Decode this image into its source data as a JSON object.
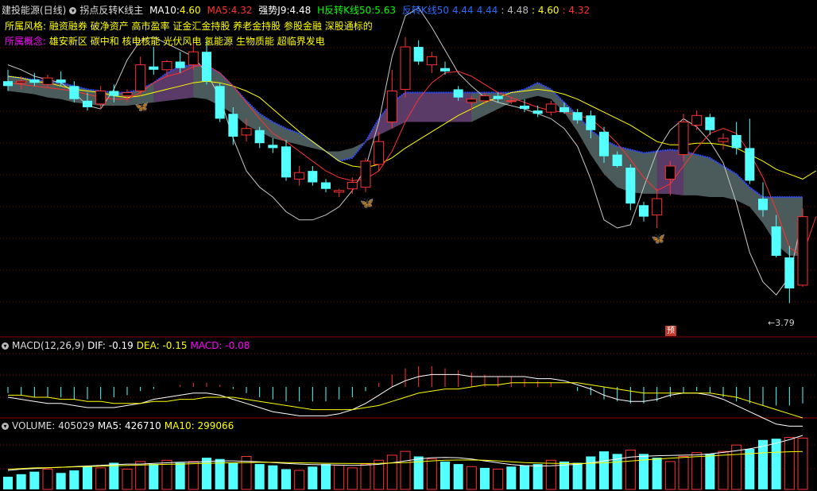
{
  "header": {
    "stock": "建投能源(日线)",
    "indicator": "拐点反转K线主",
    "ma10_label": "MA10:",
    "ma10_value": "4.60",
    "ma5_label": "MA5:",
    "ma5_value": "4.32",
    "strong_label": "强势J9:",
    "strong_value": "4.48",
    "h_rev_label": "H反转K线50:",
    "h_rev_value": "5.63",
    "rev_label": "反转K线50",
    "rev_value1": "4.44",
    "rev_value2": "4.44",
    "extra_value1": ": 4.48",
    "extra_value2": ": 4.60",
    "extra_value3": ": 4.32"
  },
  "info": {
    "style_label": "所属风格:",
    "style_value": "融资融券 破净资产 高市盈率 证金汇金持股 养老金持股 参股金融 深股通标的",
    "concept_label": "所属概念:",
    "concept_value": "雄安新区 碳中和 核电核能 光伏风电 氢能源 生物质能 超临界发电"
  },
  "annotations": {
    "low_price": "←3.79",
    "forecast": "预"
  },
  "macd_header": {
    "label": "MACD(12,26,9)",
    "dif": "DIF: -0.19",
    "dea": "DEA: -0.15",
    "macd": "MACD: -0.08"
  },
  "volume_header": {
    "label": "VOLUME: 405029",
    "ma5": "MA5: 426710",
    "ma10": "MA10: 299066"
  },
  "colors": {
    "background": "#000000",
    "up": "#ff3232",
    "down": "#54ffff",
    "yellow": "#ffff00",
    "white": "#ffffff",
    "magenta": "#ff00ff",
    "grid": "#8b0000",
    "band_gray": "#4f5f5f",
    "band_purple": "#5a3a66",
    "blue_edge": "#2a4bff"
  },
  "icons": {
    "butterfly": "butterfly-icon",
    "circle": "circle-icon"
  },
  "chart_data": {
    "type": "candlestick",
    "candles": [
      {
        "o": 5.15,
        "h": 5.22,
        "l": 5.09,
        "c": 5.12
      },
      {
        "o": 5.14,
        "h": 5.18,
        "l": 5.1,
        "c": 5.15
      },
      {
        "o": 5.16,
        "h": 5.2,
        "l": 5.12,
        "c": 5.14
      },
      {
        "o": 5.13,
        "h": 5.19,
        "l": 5.11,
        "c": 5.17
      },
      {
        "o": 5.16,
        "h": 5.21,
        "l": 5.12,
        "c": 5.14
      },
      {
        "o": 5.12,
        "h": 5.15,
        "l": 5.02,
        "c": 5.04
      },
      {
        "o": 5.03,
        "h": 5.08,
        "l": 4.97,
        "c": 4.99
      },
      {
        "o": 5.01,
        "h": 5.12,
        "l": 4.98,
        "c": 5.09
      },
      {
        "o": 5.09,
        "h": 5.13,
        "l": 5.02,
        "c": 5.06
      },
      {
        "o": 5.06,
        "h": 5.1,
        "l": 5.02,
        "c": 5.08
      },
      {
        "o": 5.09,
        "h": 5.3,
        "l": 5.06,
        "c": 5.25
      },
      {
        "o": 5.24,
        "h": 5.36,
        "l": 5.19,
        "c": 5.22
      },
      {
        "o": 5.22,
        "h": 5.28,
        "l": 5.18,
        "c": 5.27
      },
      {
        "o": 5.27,
        "h": 5.33,
        "l": 5.2,
        "c": 5.23
      },
      {
        "o": 5.25,
        "h": 5.38,
        "l": 5.22,
        "c": 5.33
      },
      {
        "o": 5.33,
        "h": 5.4,
        "l": 5.13,
        "c": 5.15
      },
      {
        "o": 5.12,
        "h": 5.14,
        "l": 4.9,
        "c": 4.92
      },
      {
        "o": 4.95,
        "h": 4.99,
        "l": 4.76,
        "c": 4.81
      },
      {
        "o": 4.82,
        "h": 4.92,
        "l": 4.78,
        "c": 4.86
      },
      {
        "o": 4.85,
        "h": 4.87,
        "l": 4.74,
        "c": 4.77
      },
      {
        "o": 4.76,
        "h": 4.8,
        "l": 4.71,
        "c": 4.74
      },
      {
        "o": 4.75,
        "h": 4.79,
        "l": 4.54,
        "c": 4.56
      },
      {
        "o": 4.55,
        "h": 4.63,
        "l": 4.51,
        "c": 4.59
      },
      {
        "o": 4.6,
        "h": 4.63,
        "l": 4.51,
        "c": 4.53
      },
      {
        "o": 4.53,
        "h": 4.55,
        "l": 4.47,
        "c": 4.49
      },
      {
        "o": 4.47,
        "h": 4.49,
        "l": 4.44,
        "c": 4.48
      },
      {
        "o": 4.49,
        "h": 4.56,
        "l": 4.46,
        "c": 4.53
      },
      {
        "o": 4.5,
        "h": 4.68,
        "l": 4.47,
        "c": 4.66
      },
      {
        "o": 4.64,
        "h": 4.84,
        "l": 4.6,
        "c": 4.78
      },
      {
        "o": 4.9,
        "h": 5.22,
        "l": 4.86,
        "c": 5.09
      },
      {
        "o": 5.1,
        "h": 5.42,
        "l": 5.05,
        "c": 5.36
      },
      {
        "o": 5.36,
        "h": 5.4,
        "l": 5.25,
        "c": 5.27
      },
      {
        "o": 5.25,
        "h": 5.33,
        "l": 5.2,
        "c": 5.3
      },
      {
        "o": 5.23,
        "h": 5.27,
        "l": 5.19,
        "c": 5.21
      },
      {
        "o": 5.1,
        "h": 5.12,
        "l": 5.03,
        "c": 5.05
      },
      {
        "o": 5.02,
        "h": 5.06,
        "l": 4.97,
        "c": 5.04
      },
      {
        "o": 5.03,
        "h": 5.08,
        "l": 5.01,
        "c": 5.06
      },
      {
        "o": 5.06,
        "h": 5.08,
        "l": 5.02,
        "c": 5.04
      },
      {
        "o": 5.03,
        "h": 5.05,
        "l": 5.01,
        "c": 5.03
      },
      {
        "o": 5.0,
        "h": 5.04,
        "l": 4.96,
        "c": 4.98
      },
      {
        "o": 4.97,
        "h": 5.0,
        "l": 4.93,
        "c": 4.95
      },
      {
        "o": 4.96,
        "h": 5.03,
        "l": 4.94,
        "c": 5.01
      },
      {
        "o": 4.99,
        "h": 5.02,
        "l": 4.95,
        "c": 4.96
      },
      {
        "o": 4.96,
        "h": 4.98,
        "l": 4.89,
        "c": 4.91
      },
      {
        "o": 4.94,
        "h": 4.97,
        "l": 4.8,
        "c": 4.85
      },
      {
        "o": 4.84,
        "h": 4.87,
        "l": 4.65,
        "c": 4.69
      },
      {
        "o": 4.7,
        "h": 4.72,
        "l": 4.62,
        "c": 4.63
      },
      {
        "o": 4.62,
        "h": 4.64,
        "l": 4.36,
        "c": 4.4
      },
      {
        "o": 4.39,
        "h": 4.41,
        "l": 4.29,
        "c": 4.32
      },
      {
        "o": 4.33,
        "h": 4.49,
        "l": 4.25,
        "c": 4.43
      },
      {
        "o": 4.55,
        "h": 4.66,
        "l": 4.45,
        "c": 4.63
      },
      {
        "o": 4.7,
        "h": 4.95,
        "l": 4.66,
        "c": 4.9
      },
      {
        "o": 4.88,
        "h": 4.97,
        "l": 4.85,
        "c": 4.94
      },
      {
        "o": 4.93,
        "h": 4.95,
        "l": 4.82,
        "c": 4.85
      },
      {
        "o": 4.78,
        "h": 4.83,
        "l": 4.73,
        "c": 4.8
      },
      {
        "o": 4.82,
        "h": 4.9,
        "l": 4.7,
        "c": 4.74
      },
      {
        "o": 4.74,
        "h": 4.92,
        "l": 4.52,
        "c": 4.54
      },
      {
        "o": 4.43,
        "h": 4.53,
        "l": 4.32,
        "c": 4.36
      },
      {
        "o": 4.26,
        "h": 4.33,
        "l": 4.07,
        "c": 4.08
      },
      {
        "o": 4.07,
        "h": 4.14,
        "l": 3.79,
        "c": 3.88
      },
      {
        "o": 3.9,
        "h": 4.37,
        "l": 3.89,
        "c": 4.32
      }
    ],
    "ma5": [
      5.14,
      5.13,
      5.12,
      5.11,
      5.1,
      5.09,
      5.07,
      5.05,
      5.04,
      5.04,
      5.08,
      5.14,
      5.18,
      5.2,
      5.24,
      5.25,
      5.2,
      5.12,
      5.02,
      4.92,
      4.83,
      4.78,
      4.72,
      4.66,
      4.6,
      4.56,
      4.54,
      4.55,
      4.6,
      4.72,
      4.9,
      5.04,
      5.14,
      5.2,
      5.21,
      5.18,
      5.13,
      5.08,
      5.05,
      5.02,
      4.99,
      4.97,
      4.96,
      4.94,
      4.92,
      4.85,
      4.77,
      4.67,
      4.56,
      4.48,
      4.52,
      4.63,
      4.74,
      4.83,
      4.86,
      4.83,
      4.71,
      4.56,
      4.36,
      4.13,
      4.08,
      4.32
    ],
    "ma10": [
      5.18,
      5.17,
      5.15,
      5.14,
      5.12,
      5.1,
      5.09,
      5.08,
      5.06,
      5.05,
      5.06,
      5.08,
      5.1,
      5.12,
      5.14,
      5.15,
      5.14,
      5.12,
      5.09,
      5.05,
      4.98,
      4.91,
      4.84,
      4.78,
      4.72,
      4.66,
      4.63,
      4.62,
      4.64,
      4.68,
      4.74,
      4.79,
      4.84,
      4.89,
      4.94,
      4.98,
      5.02,
      5.05,
      5.08,
      5.09,
      5.1,
      5.09,
      5.07,
      5.04,
      5.0,
      4.96,
      4.92,
      4.88,
      4.83,
      4.78,
      4.76,
      4.76,
      4.77,
      4.77,
      4.76,
      4.74,
      4.7,
      4.66,
      4.61,
      4.58,
      4.55,
      4.6
    ],
    "strong_j9": [
      5.25,
      5.22,
      5.18,
      5.16,
      5.14,
      5.08,
      5.0,
      4.98,
      5.1,
      5.28,
      5.4,
      5.42,
      5.38,
      5.34,
      5.3,
      5.2,
      5.05,
      4.8,
      4.6,
      4.5,
      4.44,
      4.35,
      4.3,
      4.3,
      4.33,
      4.38,
      4.48,
      4.62,
      4.9,
      5.3,
      5.55,
      5.6,
      5.48,
      5.34,
      5.2,
      5.12,
      5.05,
      5.02,
      5.0,
      4.98,
      4.95,
      4.92,
      4.86,
      4.75,
      4.55,
      4.3,
      4.25,
      4.27,
      4.5,
      4.72,
      4.85,
      4.92,
      4.87,
      4.78,
      4.65,
      4.4,
      4.1,
      3.92,
      3.84,
      3.95,
      4.32
    ],
    "band_upper": [
      5.18,
      5.17,
      5.16,
      5.15,
      5.14,
      5.12,
      5.1,
      5.09,
      5.08,
      5.08,
      5.1,
      5.14,
      5.2,
      5.24,
      5.25,
      5.24,
      5.2,
      5.12,
      5.03,
      4.95,
      4.9,
      4.86,
      4.83,
      4.78,
      4.72,
      4.66,
      4.68,
      4.78,
      4.92,
      5.02,
      5.08,
      5.08,
      5.08,
      5.08,
      5.08,
      5.08,
      5.08,
      5.08,
      5.08,
      5.1,
      5.14,
      5.1,
      5.02,
      4.94,
      4.85,
      4.79,
      4.75,
      4.73,
      4.71,
      4.72,
      4.73,
      4.72,
      4.7,
      4.68,
      4.63,
      4.58,
      4.5,
      4.44,
      4.44,
      4.44,
      4.44
    ],
    "band_lower": [
      5.09,
      5.08,
      5.07,
      5.05,
      5.04,
      5.02,
      5.01,
      5.0,
      5.0,
      5.0,
      5.01,
      5.02,
      5.03,
      5.04,
      5.05,
      5.04,
      5.0,
      4.95,
      4.88,
      4.84,
      4.8,
      4.78,
      4.76,
      4.74,
      4.72,
      4.72,
      4.74,
      4.78,
      4.82,
      4.86,
      4.9,
      4.9,
      4.9,
      4.9,
      4.9,
      4.9,
      4.94,
      4.98,
      5.02,
      5.04,
      5.06,
      5.04,
      4.96,
      4.84,
      4.7,
      4.58,
      4.5,
      4.47,
      4.46,
      4.46,
      4.46,
      4.45,
      4.45,
      4.44,
      4.44,
      4.42,
      4.38,
      4.28,
      4.15,
      4.08,
      4.08
    ],
    "band_purple_ranges": [
      [
        11,
        14
      ],
      [
        27,
        35
      ],
      [
        49,
        51
      ]
    ],
    "butterflies": [
      10,
      27,
      49
    ],
    "macd_hist": [
      -0.03,
      -0.04,
      -0.05,
      -0.05,
      -0.05,
      -0.06,
      -0.06,
      -0.06,
      -0.05,
      -0.04,
      -0.02,
      -0.01,
      0.0,
      0.01,
      0.02,
      0.02,
      0.01,
      -0.01,
      -0.03,
      -0.05,
      -0.06,
      -0.07,
      -0.07,
      -0.07,
      -0.07,
      -0.06,
      -0.05,
      -0.02,
      0.02,
      0.06,
      0.09,
      0.1,
      0.1,
      0.09,
      0.08,
      0.07,
      0.06,
      0.05,
      0.05,
      0.04,
      0.03,
      0.02,
      0.0,
      -0.02,
      -0.04,
      -0.06,
      -0.07,
      -0.08,
      -0.08,
      -0.07,
      -0.05,
      -0.03,
      -0.02,
      -0.03,
      -0.05,
      -0.07,
      -0.08,
      -0.09,
      -0.09,
      -0.09,
      -0.08
    ],
    "dif": [
      -0.05,
      -0.06,
      -0.07,
      -0.08,
      -0.08,
      -0.09,
      -0.1,
      -0.1,
      -0.1,
      -0.09,
      -0.08,
      -0.06,
      -0.05,
      -0.04,
      -0.03,
      -0.03,
      -0.04,
      -0.06,
      -0.08,
      -0.1,
      -0.12,
      -0.13,
      -0.14,
      -0.14,
      -0.14,
      -0.13,
      -0.11,
      -0.08,
      -0.04,
      0.0,
      0.03,
      0.05,
      0.06,
      0.06,
      0.06,
      0.05,
      0.05,
      0.05,
      0.05,
      0.05,
      0.04,
      0.04,
      0.03,
      0.01,
      -0.01,
      -0.04,
      -0.06,
      -0.07,
      -0.07,
      -0.06,
      -0.04,
      -0.03,
      -0.03,
      -0.04,
      -0.06,
      -0.09,
      -0.12,
      -0.15,
      -0.18,
      -0.19,
      -0.19
    ],
    "dea": [
      -0.04,
      -0.04,
      -0.05,
      -0.05,
      -0.06,
      -0.06,
      -0.07,
      -0.07,
      -0.08,
      -0.08,
      -0.08,
      -0.07,
      -0.07,
      -0.06,
      -0.06,
      -0.05,
      -0.05,
      -0.05,
      -0.06,
      -0.07,
      -0.08,
      -0.09,
      -0.1,
      -0.11,
      -0.11,
      -0.11,
      -0.11,
      -0.1,
      -0.09,
      -0.07,
      -0.05,
      -0.03,
      -0.02,
      -0.01,
      -0.01,
      0.0,
      0.01,
      0.01,
      0.02,
      0.02,
      0.02,
      0.02,
      0.02,
      0.02,
      0.01,
      0.0,
      -0.01,
      -0.02,
      -0.03,
      -0.03,
      -0.03,
      -0.03,
      -0.03,
      -0.03,
      -0.04,
      -0.05,
      -0.07,
      -0.09,
      -0.11,
      -0.13,
      -0.15
    ],
    "volume": [
      100,
      120,
      140,
      160,
      130,
      150,
      180,
      170,
      210,
      160,
      220,
      200,
      230,
      210,
      220,
      250,
      240,
      210,
      260,
      200,
      190,
      160,
      150,
      180,
      200,
      190,
      170,
      200,
      230,
      270,
      300,
      260,
      240,
      220,
      200,
      180,
      170,
      160,
      180,
      190,
      200,
      230,
      220,
      210,
      260,
      300,
      280,
      310,
      280,
      250,
      220,
      260,
      290,
      280,
      300,
      350,
      320,
      390,
      400,
      410,
      405
    ],
    "vol_ma5": [
      150,
      160,
      165,
      170,
      175,
      180,
      185,
      190,
      195,
      200,
      200,
      205,
      210,
      215,
      215,
      220,
      225,
      225,
      222,
      218,
      212,
      205,
      200,
      196,
      194,
      192,
      190,
      192,
      198,
      210,
      225,
      240,
      250,
      252,
      250,
      240,
      225,
      210,
      196,
      188,
      184,
      186,
      192,
      198,
      210,
      225,
      240,
      255,
      262,
      266,
      268,
      270,
      272,
      280,
      292,
      305,
      320,
      340,
      365,
      392,
      426
    ],
    "vol_ma10": [
      160,
      165,
      170,
      172,
      175,
      178,
      180,
      183,
      186,
      190,
      192,
      195,
      198,
      200,
      203,
      206,
      208,
      210,
      212,
      214,
      214,
      212,
      210,
      208,
      206,
      205,
      204,
      204,
      205,
      208,
      212,
      218,
      225,
      230,
      232,
      232,
      230,
      225,
      218,
      212,
      208,
      206,
      204,
      204,
      206,
      210,
      216,
      224,
      232,
      240,
      246,
      252,
      258,
      264,
      270,
      276,
      282,
      288,
      293,
      297,
      299
    ],
    "volume_up": [
      0,
      0,
      0,
      1,
      0,
      0,
      0,
      1,
      0,
      1,
      1,
      0,
      1,
      0,
      1,
      0,
      0,
      0,
      1,
      0,
      0,
      0,
      1,
      0,
      0,
      1,
      1,
      1,
      1,
      1,
      1,
      0,
      1,
      0,
      0,
      1,
      0,
      1,
      0,
      0,
      0,
      1,
      0,
      0,
      0,
      0,
      0,
      1,
      0,
      0,
      1,
      1,
      1,
      0,
      1,
      1,
      0,
      0,
      0,
      1,
      1
    ]
  }
}
